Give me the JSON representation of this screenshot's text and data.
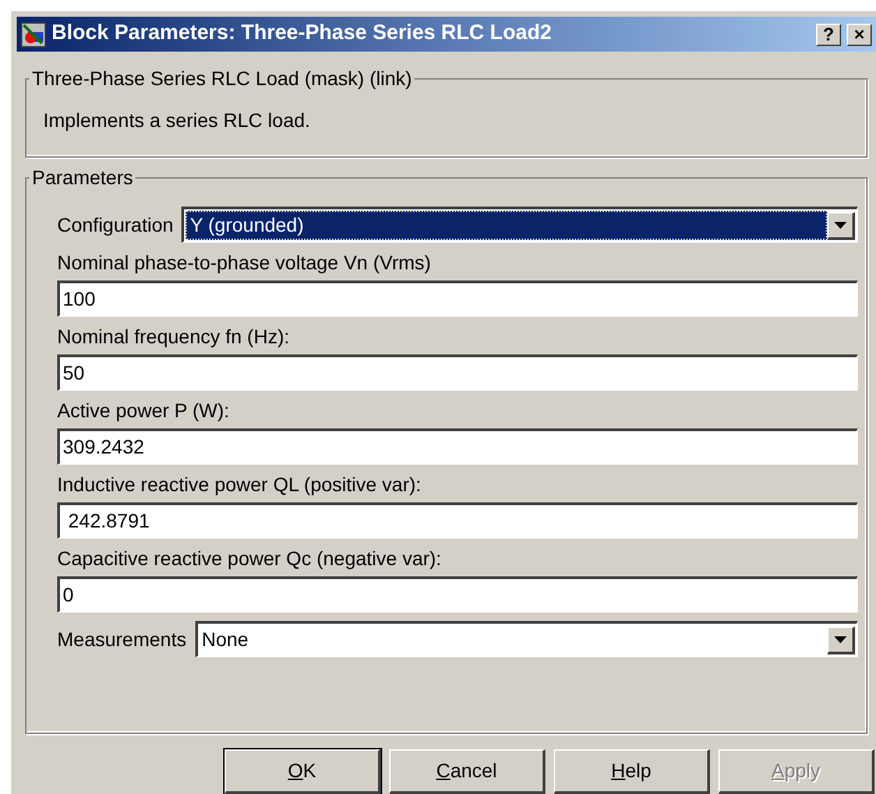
{
  "window": {
    "title": "Block Parameters: Three-Phase Series RLC Load2",
    "title_buttons": [
      "?",
      "×"
    ]
  },
  "description_group": {
    "title": "Three-Phase Series RLC Load (mask) (link)",
    "text": "Implements a series RLC load."
  },
  "parameters_group": {
    "title": "Parameters",
    "fields": [
      {
        "kind": "dropdown",
        "label": "Configuration",
        "value": "Y (grounded)",
        "focused": true
      },
      {
        "kind": "text",
        "label": "Nominal phase-to-phase voltage Vn (Vrms)",
        "value": "100"
      },
      {
        "kind": "text",
        "label": "Nominal frequency fn (Hz):",
        "value": "50"
      },
      {
        "kind": "text",
        "label": "Active power P (W):",
        "value": "309.2432"
      },
      {
        "kind": "text",
        "label": "Inductive reactive power QL (positive var):",
        "value": " 242.8791"
      },
      {
        "kind": "text",
        "label": "Capacitive reactive power Qc (negative var):",
        "value": "0"
      },
      {
        "kind": "dropdown",
        "label": "Measurements",
        "value": "None",
        "focused": false
      }
    ]
  },
  "buttons": [
    {
      "label": "OK",
      "default": true,
      "disabled": false
    },
    {
      "label": "Cancel",
      "default": false,
      "disabled": false
    },
    {
      "label": "Help",
      "default": false,
      "disabled": false
    },
    {
      "label": "Apply",
      "default": false,
      "disabled": true
    }
  ]
}
